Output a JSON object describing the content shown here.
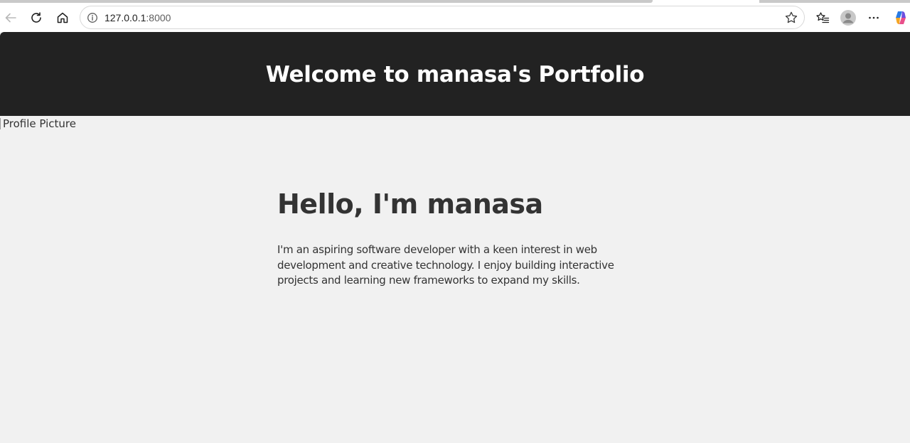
{
  "browser": {
    "url_host": "127.0.0.1",
    "url_port": ":8000",
    "icons": {
      "back": "back-arrow-icon",
      "reload": "reload-icon",
      "home": "home-icon",
      "site_info": "info-icon",
      "favorite": "star-icon",
      "favorites_list": "favorites-icon",
      "profile": "profile-avatar-icon",
      "menu": "more-icon",
      "copilot": "copilot-icon"
    }
  },
  "header": {
    "title": "Welcome to manasa's Portfolio"
  },
  "profile_image": {
    "alt": "Profile Picture"
  },
  "intro": {
    "heading": "Hello, I'm manasa",
    "body": "I'm an aspiring software developer with a keen interest in web development and creative technology. I enjoy building interactive projects and learning new frameworks to expand my skills."
  },
  "colors": {
    "header_bg": "#222222",
    "page_bg": "#f1f1f1",
    "text": "#333333"
  }
}
